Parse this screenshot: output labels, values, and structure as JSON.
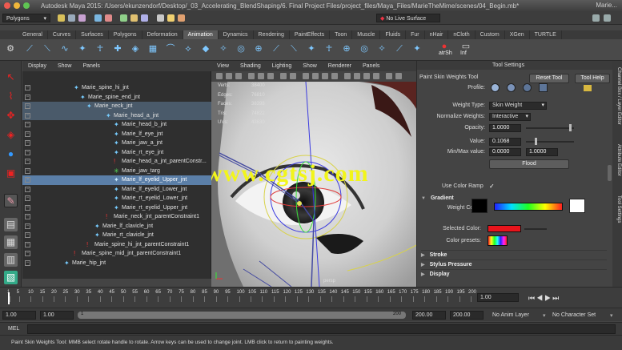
{
  "title_bar": {
    "text": "Autodesk Maya 2015: /Users/ekunzendorf/Desktop/_03_Accelerating_BlendShaping/6. Final Project Files/project_files/Maya_Files/MarieTheMime/scenes/04_Begin.mb*",
    "right_text": "Marie..."
  },
  "status_line": {
    "menu_set": "Polygons",
    "live_surface": "No Live Surface"
  },
  "shelf_tabs": [
    "General",
    "Curves",
    "Surfaces",
    "Polygons",
    "Deformation",
    "Animation",
    "Dynamics",
    "Rendering",
    "PaintEffects",
    "Toon",
    "Muscle",
    "Fluids",
    "Fur",
    "nHair",
    "nCloth",
    "Custom",
    "XGen",
    "TURTLE"
  ],
  "shelf": {
    "atrsh_label": "atrSh",
    "inf_label": "Inf"
  },
  "outliner": {
    "menus": [
      "Display",
      "Show",
      "Panels"
    ],
    "rows": [
      {
        "label": "Marie_spine_hi_jnt"
      },
      {
        "label": "Marie_spine_end_jnt"
      },
      {
        "label": "Marie_neck_jnt"
      },
      {
        "label": "Marie_head_a_jnt"
      },
      {
        "label": "Marie_head_b_jnt"
      },
      {
        "label": "Marie_lf_eye_jnt"
      },
      {
        "label": "Marie_jaw_a_jnt"
      },
      {
        "label": "Marie_rt_eye_jnt"
      },
      {
        "label": "Marie_head_a_jnt_parentConstr..."
      },
      {
        "label": "Marie_jaw_targ"
      },
      {
        "label": "Marie_lf_eyelid_Upper_jnt"
      },
      {
        "label": "Marie_lf_eyelid_Lower_jnt"
      },
      {
        "label": "Marie_rt_eyelid_Lower_jnt"
      },
      {
        "label": "Marie_rt_eyelid_Upper_jnt"
      },
      {
        "label": "Marie_neck_jnt_parentConstraint1"
      },
      {
        "label": "Marie_lf_clavicle_jnt"
      },
      {
        "label": "Marie_rt_clavicle_jnt"
      },
      {
        "label": "Marie_spine_hi_jnt_parentConstraint1"
      },
      {
        "label": "Marie_spine_mid_jnt_parentConstraint1"
      },
      {
        "label": "Marie_hip_jnt"
      }
    ]
  },
  "viewport": {
    "menus": [
      "View",
      "Shading",
      "Lighting",
      "Show",
      "Renderer",
      "Panels"
    ],
    "hud": [
      {
        "label": "Verts:",
        "value": "38400"
      },
      {
        "label": "Edges:",
        "value": "76810"
      },
      {
        "label": "Faces:",
        "value": "38398"
      },
      {
        "label": "Tris:",
        "value": "74822"
      },
      {
        "label": "UVs:",
        "value": "43630"
      }
    ],
    "watermark": "www.cgtsj.com",
    "camera": "persp"
  },
  "tool_settings": {
    "header": "Tool Settings",
    "tool_name": "Paint Skin Weights Tool",
    "reset_button": "Reset Tool",
    "help_button": "Tool Help",
    "profile_label": "Profile:",
    "weight_type_label": "Weight Type:",
    "weight_type_value": "Skin Weight",
    "normalize_label": "Normalize Weights:",
    "normalize_value": "Interactive",
    "opacity_label": "Opacity:",
    "opacity_value": "1.0000",
    "value_label": "Value:",
    "value_value": "0.1068",
    "minmax_label": "Min/Max value:",
    "min_value": "0.0000",
    "max_value": "1.0000",
    "flood_button": "Flood",
    "gradient_header": "Gradient",
    "use_color_ramp": "Use Color Ramp",
    "use_color_ramp_checked": "✓",
    "weight_color_label": "Weight Color:",
    "selected_color_label": "Selected Color:",
    "color_presets_label": "Color presets:",
    "sections": [
      "Stroke",
      "Stylus Pressure",
      "Display"
    ],
    "selected_color": "#e8141c"
  },
  "side_tabs": [
    "Channel Box / Layer Editor",
    "Attribute Editor",
    "Tool Settings"
  ],
  "timeline": {
    "ticks": [
      "1",
      "5",
      "10",
      "15",
      "20",
      "25",
      "30",
      "35",
      "40",
      "45",
      "50",
      "55",
      "60",
      "65",
      "70",
      "75",
      "80",
      "85",
      "90",
      "95",
      "100",
      "105",
      "110",
      "115",
      "120",
      "125",
      "130",
      "135",
      "140",
      "145",
      "150",
      "155",
      "160",
      "165",
      "170",
      "175",
      "180",
      "185",
      "190",
      "195",
      "200"
    ],
    "current_frame": "1.00"
  },
  "range": {
    "start": "1.00",
    "playback_start": "1.00",
    "range_label": "1",
    "range_end_label": "200",
    "playback_end": "200.00",
    "end": "200.00",
    "anim_layer": "No Anim Layer",
    "character_set": "No Character Set"
  },
  "command_line": {
    "label": "MEL"
  },
  "help_line": "Paint Skin Weights Tool: MMB select rotate handle to rotate. Arrow keys can be used to change joint. LMB click to return to painting weights."
}
